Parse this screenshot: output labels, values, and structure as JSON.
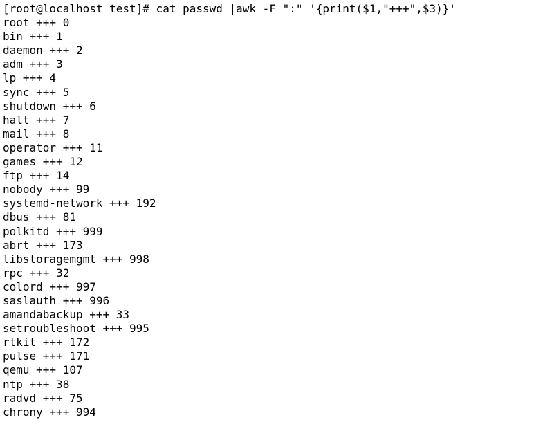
{
  "terminal": {
    "command_line": "[root@localhost test]# cat passwd |awk -F \":\" '{print($1,\"+++\",$3)}'",
    "output_lines": [
      "root +++ 0",
      "bin +++ 1",
      "daemon +++ 2",
      "adm +++ 3",
      "lp +++ 4",
      "sync +++ 5",
      "shutdown +++ 6",
      "halt +++ 7",
      "mail +++ 8",
      "operator +++ 11",
      "games +++ 12",
      "ftp +++ 14",
      "nobody +++ 99",
      "systemd-network +++ 192",
      "dbus +++ 81",
      "polkitd +++ 999",
      "abrt +++ 173",
      "libstoragemgmt +++ 998",
      "rpc +++ 32",
      "colord +++ 997",
      "saslauth +++ 996",
      "amandabackup +++ 33",
      "setroubleshoot +++ 995",
      "rtkit +++ 172",
      "pulse +++ 171",
      "qemu +++ 107",
      "ntp +++ 38",
      "radvd +++ 75",
      "chrony +++ 994"
    ]
  },
  "colors": {
    "background": "#ffffff",
    "text": "#000000"
  }
}
